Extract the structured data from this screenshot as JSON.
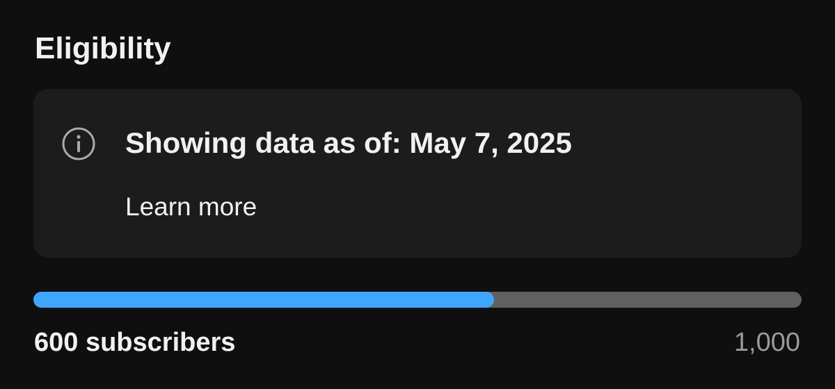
{
  "section": {
    "title": "Eligibility"
  },
  "info_card": {
    "icon": "info-icon",
    "date_text": "Showing data as of: May 7, 2025",
    "learn_more_label": "Learn more"
  },
  "progress": {
    "current_label": "600 subscribers",
    "current_value": 600,
    "goal_label": "1,000",
    "goal_value": 1000,
    "fraction": 0.6
  },
  "colors": {
    "background": "#0f0f0f",
    "card": "#1c1c1c",
    "progress_fill": "#3ea6ff",
    "progress_track": "#606060",
    "muted_text": "#9a9a9a"
  }
}
